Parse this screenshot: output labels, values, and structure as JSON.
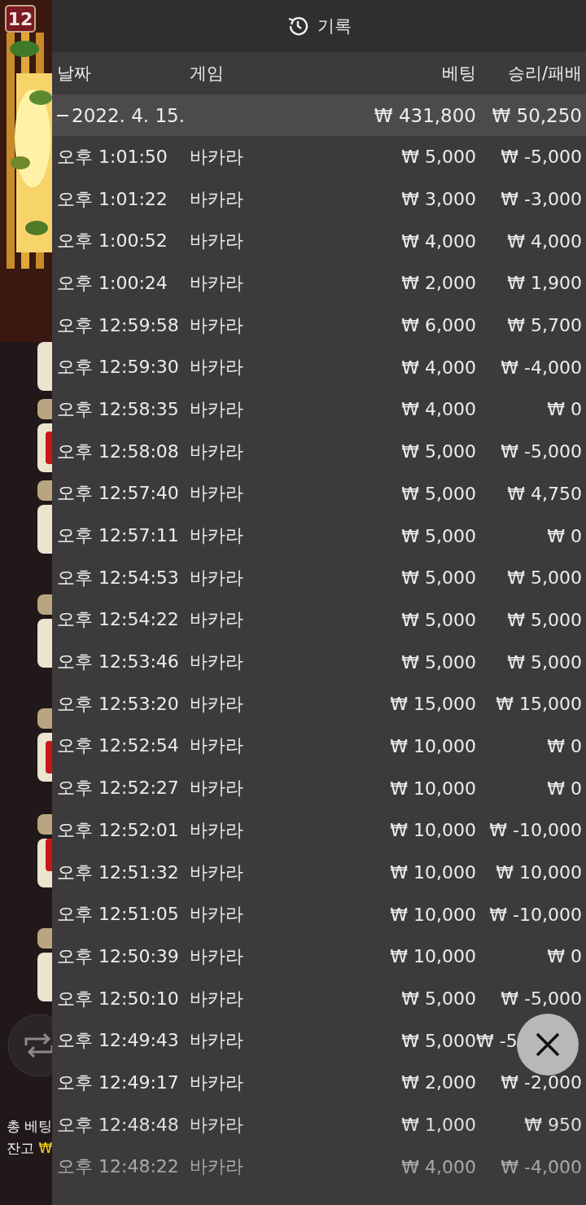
{
  "game": {
    "badge": "12",
    "total_bet_label": "총 베팅",
    "balance_label": "잔고",
    "balance_currency": "₩"
  },
  "panel": {
    "title": "기록",
    "columns": [
      "날짜",
      "게임",
      "베팅",
      "승리/패배"
    ],
    "group": {
      "label": "2022. 4. 15.",
      "bet": "₩ 431,800",
      "result": "₩ 50,250",
      "expanded": true
    },
    "rows": [
      {
        "time": "오후 1:01:50",
        "game": "바카라",
        "bet": "₩ 5,000",
        "result": "₩ -5,000"
      },
      {
        "time": "오후 1:01:22",
        "game": "바카라",
        "bet": "₩ 3,000",
        "result": "₩ -3,000"
      },
      {
        "time": "오후 1:00:52",
        "game": "바카라",
        "bet": "₩ 4,000",
        "result": "₩ 4,000"
      },
      {
        "time": "오후 1:00:24",
        "game": "바카라",
        "bet": "₩ 2,000",
        "result": "₩ 1,900"
      },
      {
        "time": "오후 12:59:58",
        "game": "바카라",
        "bet": "₩ 6,000",
        "result": "₩ 5,700"
      },
      {
        "time": "오후 12:59:30",
        "game": "바카라",
        "bet": "₩ 4,000",
        "result": "₩ -4,000"
      },
      {
        "time": "오후 12:58:35",
        "game": "바카라",
        "bet": "₩ 4,000",
        "result": "₩ 0"
      },
      {
        "time": "오후 12:58:08",
        "game": "바카라",
        "bet": "₩ 5,000",
        "result": "₩ -5,000"
      },
      {
        "time": "오후 12:57:40",
        "game": "바카라",
        "bet": "₩ 5,000",
        "result": "₩ 4,750"
      },
      {
        "time": "오후 12:57:11",
        "game": "바카라",
        "bet": "₩ 5,000",
        "result": "₩ 0"
      },
      {
        "time": "오후 12:54:53",
        "game": "바카라",
        "bet": "₩ 5,000",
        "result": "₩ 5,000"
      },
      {
        "time": "오후 12:54:22",
        "game": "바카라",
        "bet": "₩ 5,000",
        "result": "₩ 5,000"
      },
      {
        "time": "오후 12:53:46",
        "game": "바카라",
        "bet": "₩ 5,000",
        "result": "₩ 5,000"
      },
      {
        "time": "오후 12:53:20",
        "game": "바카라",
        "bet": "₩ 15,000",
        "result": "₩ 15,000"
      },
      {
        "time": "오후 12:52:54",
        "game": "바카라",
        "bet": "₩ 10,000",
        "result": "₩ 0"
      },
      {
        "time": "오후 12:52:27",
        "game": "바카라",
        "bet": "₩ 10,000",
        "result": "₩ 0"
      },
      {
        "time": "오후 12:52:01",
        "game": "바카라",
        "bet": "₩ 10,000",
        "result": "₩ -10,000"
      },
      {
        "time": "오후 12:51:32",
        "game": "바카라",
        "bet": "₩ 10,000",
        "result": "₩ 10,000"
      },
      {
        "time": "오후 12:51:05",
        "game": "바카라",
        "bet": "₩ 10,000",
        "result": "₩ -10,000"
      },
      {
        "time": "오후 12:50:39",
        "game": "바카라",
        "bet": "₩ 10,000",
        "result": "₩ 0"
      },
      {
        "time": "오후 12:50:10",
        "game": "바카라",
        "bet": "₩ 5,000",
        "result": "₩ -5,000"
      },
      {
        "time": "오후 12:49:43",
        "game": "바카라",
        "bet": "₩ 5,000",
        "result": "₩ -5",
        "covered": true
      },
      {
        "time": "오후 12:49:17",
        "game": "바카라",
        "bet": "₩ 2,000",
        "result": "₩ -2,000"
      },
      {
        "time": "오후 12:48:48",
        "game": "바카라",
        "bet": "₩ 1,000",
        "result": "₩ 950"
      },
      {
        "time": "오후 12:48:22",
        "game": "바카라",
        "bet": "₩ 4,000",
        "result": "₩ -4,000"
      }
    ]
  }
}
